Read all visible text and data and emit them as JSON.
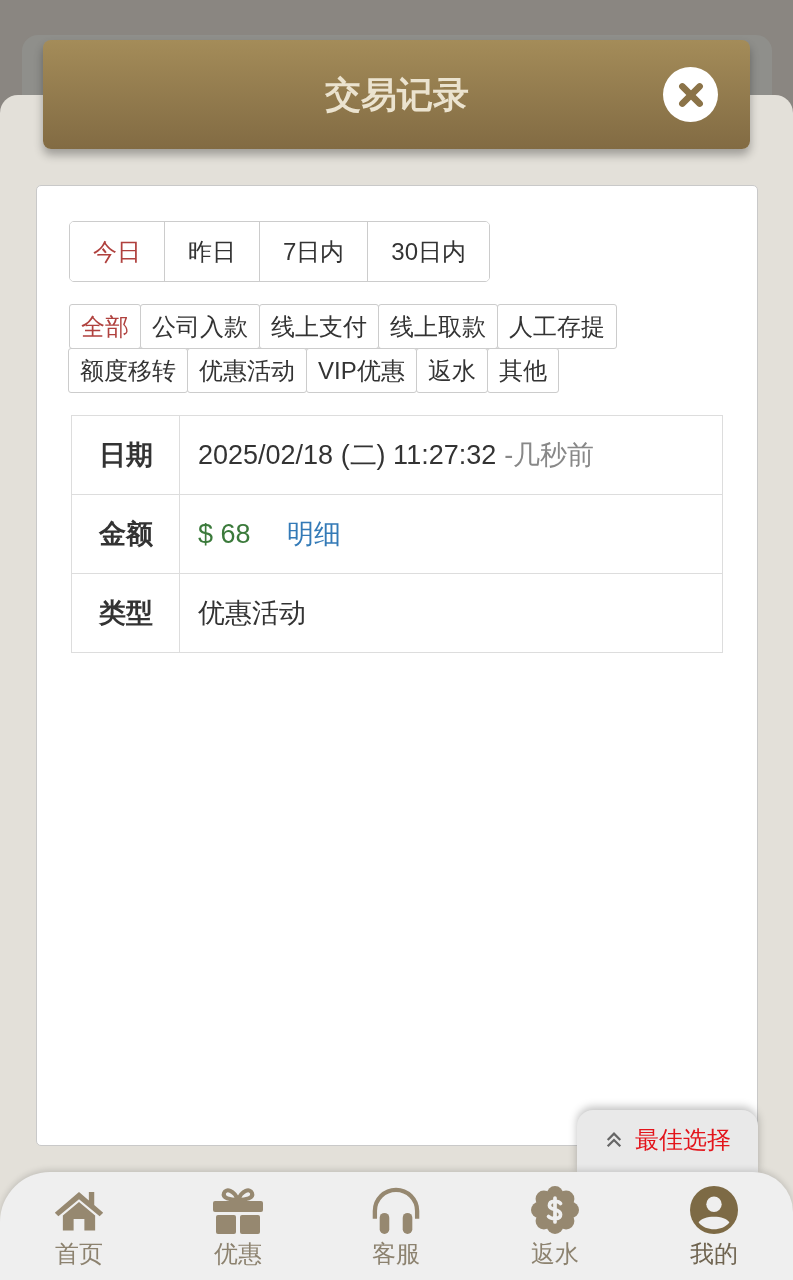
{
  "title_bar": {
    "title": "交易记录"
  },
  "date_tabs": [
    {
      "label": "今日",
      "selected": true
    },
    {
      "label": "昨日",
      "selected": false
    },
    {
      "label": "7日内",
      "selected": false
    },
    {
      "label": "30日内",
      "selected": false
    }
  ],
  "type_tabs": [
    {
      "label": "全部",
      "selected": true
    },
    {
      "label": "公司入款",
      "selected": false
    },
    {
      "label": "线上支付",
      "selected": false
    },
    {
      "label": "线上取款",
      "selected": false
    },
    {
      "label": "人工存提",
      "selected": false
    },
    {
      "label": "额度移转",
      "selected": false
    },
    {
      "label": "优惠活动",
      "selected": false
    },
    {
      "label": "VIP优惠",
      "selected": false
    },
    {
      "label": "返水",
      "selected": false
    },
    {
      "label": "其他",
      "selected": false
    }
  ],
  "record": {
    "rows": [
      {
        "kind": "date",
        "label": "日期",
        "value": "2025/02/18 (二) 11:27:32",
        "note": "-几秒前"
      },
      {
        "kind": "amount",
        "label": "金额",
        "value": "$ 68",
        "link": "明细"
      },
      {
        "kind": "text",
        "label": "类型",
        "value": "优惠活动"
      }
    ]
  },
  "float_button": {
    "label": "最佳选择"
  },
  "bottom_nav": [
    {
      "kind": "home",
      "label": "首页",
      "selected": false
    },
    {
      "kind": "gift",
      "label": "优惠",
      "selected": false
    },
    {
      "kind": "headset",
      "label": "客服",
      "selected": false
    },
    {
      "kind": "rebate",
      "label": "返水",
      "selected": false
    },
    {
      "kind": "user",
      "label": "我的",
      "selected": true
    }
  ]
}
